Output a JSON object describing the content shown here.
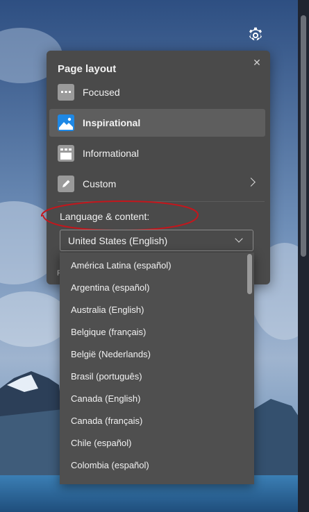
{
  "panel": {
    "title": "Page layout",
    "close_icon": "close-icon",
    "layouts": [
      {
        "label": "Focused",
        "icon": "focused-layout-icon",
        "selected": false
      },
      {
        "label": "Inspirational",
        "icon": "inspirational-layout-icon",
        "selected": true
      },
      {
        "label": "Informational",
        "icon": "informational-layout-icon",
        "selected": false
      },
      {
        "label": "Custom",
        "icon": "pencil-icon",
        "selected": false
      }
    ],
    "language_label": "Language & content:",
    "language_selected": "United States (English)"
  },
  "dropdown": {
    "options": [
      "América Latina (español)",
      "Argentina (español)",
      "Australia (English)",
      "Belgique (français)",
      "België (Nederlands)",
      "Brasil (português)",
      "Canada (English)",
      "Canada (français)",
      "Chile (español)",
      "Colombia (español)"
    ]
  },
  "colors": {
    "panel_bg": "#4a4a4a",
    "selected_bg": "#5e5e5e",
    "annotation_red": "#c4161c",
    "icon_blue": "#1e88e5"
  }
}
